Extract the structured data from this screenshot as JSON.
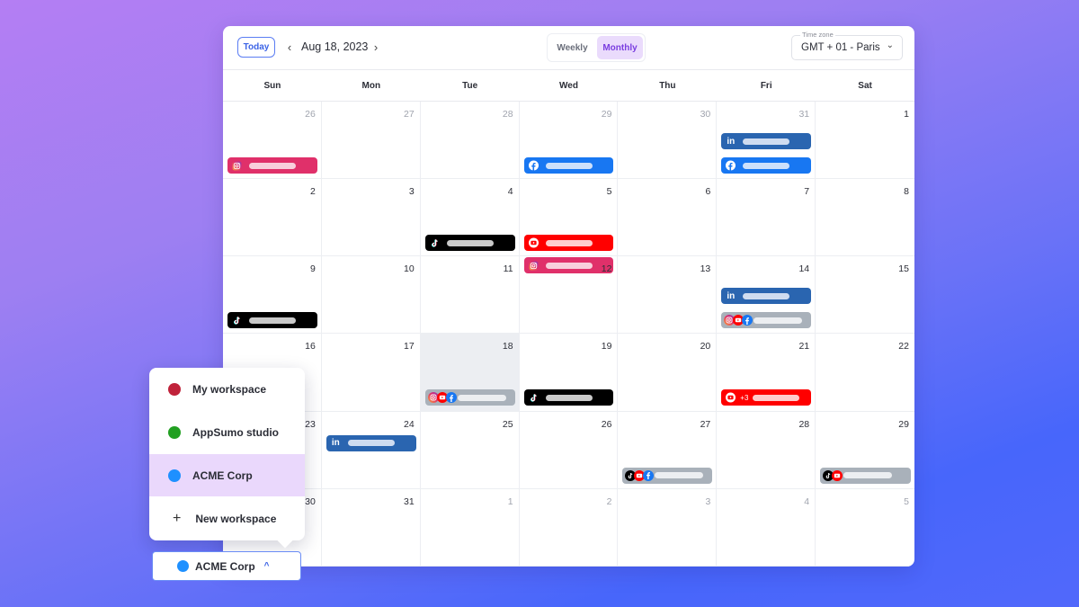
{
  "toolbar": {
    "today_label": "Today",
    "prev_icon": "‹",
    "next_icon": "›",
    "current_date": "Aug 18, 2023",
    "views": [
      {
        "label": "Weekly",
        "active": false
      },
      {
        "label": "Monthly",
        "active": true
      }
    ],
    "timezone": {
      "legend": "Time zone",
      "value": "GMT + 01 - Paris",
      "chevron": "⌄"
    }
  },
  "weekdays": [
    "Sun",
    "Mon",
    "Tue",
    "Wed",
    "Thu",
    "Fri",
    "Sat"
  ],
  "today_index": 25,
  "days": [
    {
      "num": "26",
      "muted": true,
      "events": [
        {
          "type": "instagram",
          "slot": 2
        }
      ]
    },
    {
      "num": "27",
      "muted": true,
      "events": []
    },
    {
      "num": "28",
      "muted": true,
      "events": []
    },
    {
      "num": "29",
      "muted": true,
      "events": [
        {
          "type": "facebook",
          "slot": 2
        }
      ]
    },
    {
      "num": "30",
      "muted": true,
      "events": []
    },
    {
      "num": "31",
      "muted": true,
      "events": [
        {
          "type": "linkedin",
          "slot": 1
        },
        {
          "type": "facebook",
          "slot": 2
        }
      ]
    },
    {
      "num": "1",
      "muted": false,
      "events": []
    },
    {
      "num": "2",
      "muted": false,
      "events": []
    },
    {
      "num": "3",
      "muted": false,
      "events": []
    },
    {
      "num": "4",
      "muted": false,
      "events": [
        {
          "type": "tiktok",
          "slot": 2
        }
      ]
    },
    {
      "num": "5",
      "muted": false,
      "events": [
        {
          "type": "youtube",
          "slot": 2
        },
        {
          "type": "instagram",
          "slot": 3
        }
      ]
    },
    {
      "num": "6",
      "muted": false,
      "events": []
    },
    {
      "num": "7",
      "muted": false,
      "events": []
    },
    {
      "num": "8",
      "muted": false,
      "events": []
    },
    {
      "num": "9",
      "muted": false,
      "events": [
        {
          "type": "tiktok",
          "slot": 2
        }
      ]
    },
    {
      "num": "10",
      "muted": false,
      "events": []
    },
    {
      "num": "11",
      "muted": false,
      "events": []
    },
    {
      "num": "12",
      "muted": false,
      "events": []
    },
    {
      "num": "13",
      "muted": false,
      "events": []
    },
    {
      "num": "14",
      "muted": false,
      "events": [
        {
          "type": "linkedin",
          "slot": 1
        },
        {
          "type": "multi",
          "icons": [
            "instagram",
            "youtube",
            "facebook"
          ],
          "slot": 2
        }
      ]
    },
    {
      "num": "15",
      "muted": false,
      "events": []
    },
    {
      "num": "16",
      "muted": false,
      "events": []
    },
    {
      "num": "17",
      "muted": false,
      "events": []
    },
    {
      "num": "18",
      "muted": false,
      "events": [
        {
          "type": "multi",
          "icons": [
            "instagram",
            "youtube",
            "facebook"
          ],
          "slot": 2
        }
      ]
    },
    {
      "num": "19",
      "muted": false,
      "events": [
        {
          "type": "tiktok",
          "slot": 2
        }
      ]
    },
    {
      "num": "20",
      "muted": false,
      "events": []
    },
    {
      "num": "21",
      "muted": false,
      "events": [
        {
          "type": "youtube",
          "count": "+3",
          "slot": 2
        }
      ]
    },
    {
      "num": "22",
      "muted": false,
      "events": []
    },
    {
      "num": "23",
      "muted": false,
      "events": []
    },
    {
      "num": "24",
      "muted": false,
      "events": [
        {
          "type": "linkedin",
          "slot": 0
        }
      ]
    },
    {
      "num": "25",
      "muted": false,
      "events": []
    },
    {
      "num": "26",
      "muted": false,
      "events": []
    },
    {
      "num": "27",
      "muted": false,
      "events": [
        {
          "type": "multi",
          "icons": [
            "tiktok",
            "youtube",
            "facebook"
          ],
          "slot": 2
        }
      ]
    },
    {
      "num": "28",
      "muted": false,
      "events": []
    },
    {
      "num": "29",
      "muted": false,
      "events": [
        {
          "type": "multi",
          "icons": [
            "tiktok",
            "youtube"
          ],
          "slot": 2
        }
      ]
    },
    {
      "num": "30",
      "muted": false,
      "events": []
    },
    {
      "num": "31",
      "muted": false,
      "events": []
    },
    {
      "num": "1",
      "muted": true,
      "events": []
    },
    {
      "num": "2",
      "muted": true,
      "events": []
    },
    {
      "num": "3",
      "muted": true,
      "events": []
    },
    {
      "num": "4",
      "muted": true,
      "events": []
    },
    {
      "num": "5",
      "muted": true,
      "events": []
    }
  ],
  "workspace_menu": {
    "items": [
      {
        "label": "My workspace",
        "color": "#c0223a",
        "selected": false
      },
      {
        "label": "AppSumo studio",
        "color": "#22a022",
        "selected": false
      },
      {
        "label": "ACME Corp",
        "color": "#1e90ff",
        "selected": true
      }
    ],
    "new_label": "New workspace",
    "new_icon": "+"
  },
  "workspace_button": {
    "label": "ACME Corp",
    "color": "#1e90ff",
    "chevron": "^"
  },
  "colors": {
    "linkedin": "#2a65b0",
    "facebook": "#1877f2",
    "instagram": "#e0306a",
    "tiktok": "#000000",
    "youtube": "#ff0000",
    "multi": "#a9b1ba",
    "accent": "#7a3ee0"
  }
}
